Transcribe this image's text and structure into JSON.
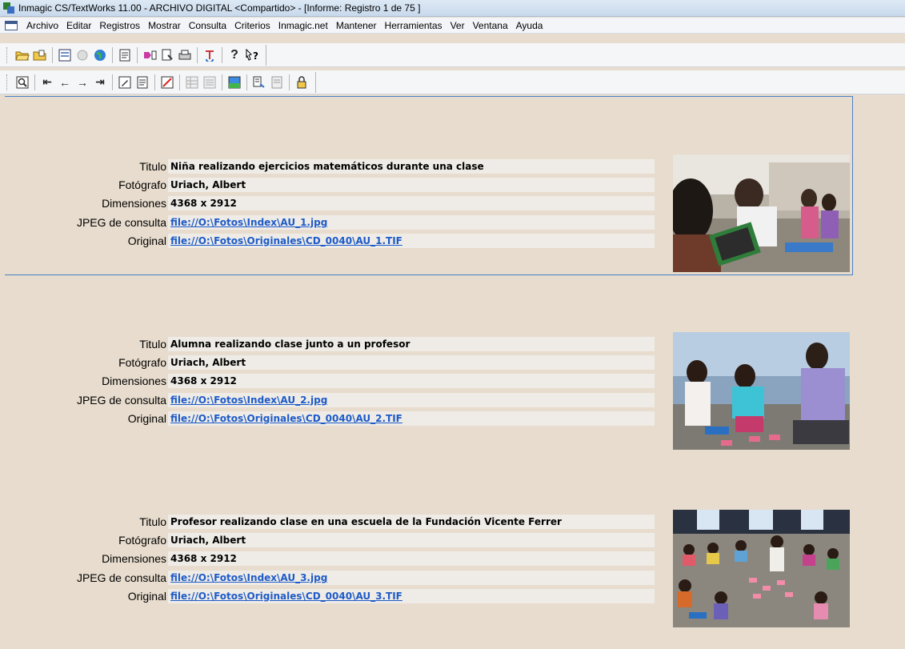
{
  "window": {
    "title": "Inmagic CS/TextWorks 11.00  - ARCHIVO DIGITAL <Compartido> - [Informe: Registro 1 de 75 ]"
  },
  "menu": [
    "Archivo",
    "Editar",
    "Registros",
    "Mostrar",
    "Consulta",
    "Criterios",
    "Inmagic.net",
    "Mantener",
    "Herramientas",
    "Ver",
    "Ventana",
    "Ayuda"
  ],
  "labels": {
    "titulo": "Titulo",
    "fotografo": "Fotógrafo",
    "dimensiones": "Dimensiones",
    "jpeg": "JPEG de consulta",
    "original": "Original"
  },
  "records": [
    {
      "titulo": "Niña realizando ejercicios matemáticos durante una clase",
      "fotografo": "Uriach, Albert",
      "dimensiones": "4368 x 2912",
      "jpeg": "file://O:\\Fotos\\Index\\AU_1.jpg",
      "original": "file://O:\\Fotos\\Originales\\CD_0040\\AU_1.TIF"
    },
    {
      "titulo": "Alumna realizando clase junto a un profesor",
      "fotografo": "Uriach, Albert",
      "dimensiones": "4368 x 2912",
      "jpeg": "file://O:\\Fotos\\Index\\AU_2.jpg",
      "original": "file://O:\\Fotos\\Originales\\CD_0040\\AU_2.TIF"
    },
    {
      "titulo": "Profesor realizando clase en una escuela de la Fundación Vicente Ferrer",
      "fotografo": "Uriach, Albert",
      "dimensiones": "4368 x 2912",
      "jpeg": "file://O:\\Fotos\\Index\\AU_3.jpg",
      "original": "file://O:\\Fotos\\Originales\\CD_0040\\AU_3.TIF"
    }
  ],
  "colors": {
    "background": "#e7dccd",
    "link": "#1e5bc8",
    "focus_border": "#4a82c8"
  }
}
